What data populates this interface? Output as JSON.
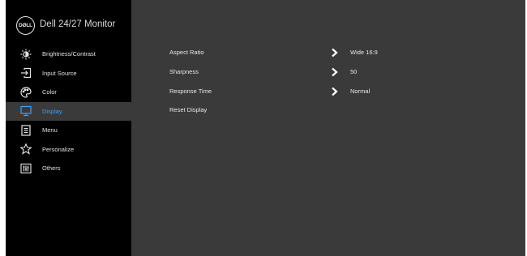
{
  "brand": {
    "logo_text": "DØLL",
    "model": "Dell 24/27 Monitor"
  },
  "menu": [
    {
      "label": "Brightness/Contrast",
      "icon": "brightness-icon",
      "active": false
    },
    {
      "label": "Input Source",
      "icon": "input-source-icon",
      "active": false
    },
    {
      "label": "Color",
      "icon": "color-palette-icon",
      "active": false
    },
    {
      "label": "Display",
      "icon": "display-monitor-icon",
      "active": true
    },
    {
      "label": "Menu",
      "icon": "menu-doc-icon",
      "active": false
    },
    {
      "label": "Personalize",
      "icon": "star-icon",
      "active": false
    },
    {
      "label": "Others",
      "icon": "others-icon",
      "active": false
    }
  ],
  "display_settings": [
    {
      "name": "Aspect Ratio",
      "value": "Wide 16:9",
      "has_submenu": true
    },
    {
      "name": "Sharpness",
      "value": "50",
      "has_submenu": true
    },
    {
      "name": "Response Time",
      "value": "Normal",
      "has_submenu": true
    },
    {
      "name": "Reset Display",
      "value": "",
      "has_submenu": false
    }
  ],
  "colors": {
    "accent": "#3aa0ff",
    "sidebar_bg": "#000000",
    "panel_bg": "#3a3a3a",
    "text": "#e8e8e8"
  }
}
